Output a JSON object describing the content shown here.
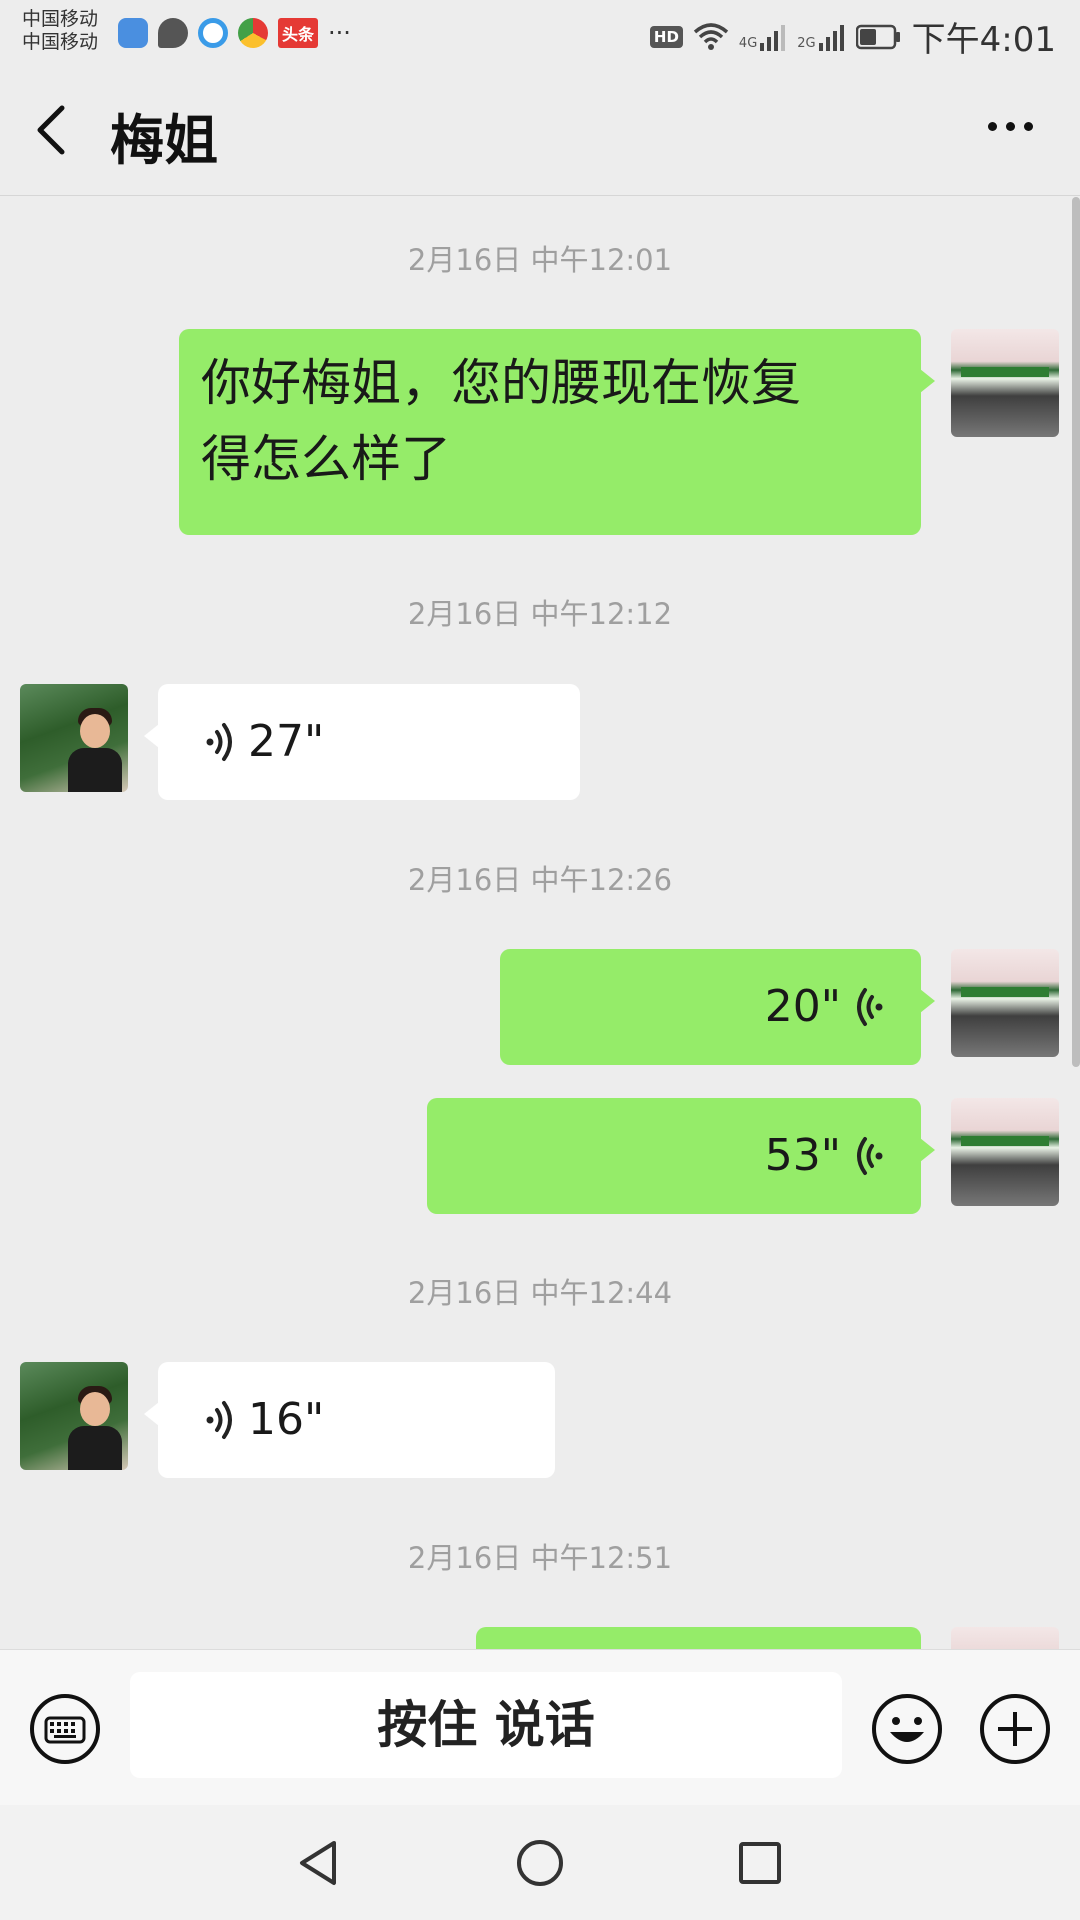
{
  "status_bar": {
    "carrier_1": "中国移动",
    "carrier_2": "中国移动",
    "notification_badge": "头条",
    "more": "···",
    "hd": "HD",
    "net_1": "4G",
    "net_2": "2G",
    "time": "下午4:01",
    "battery_level": 0.5
  },
  "header": {
    "title": "梅姐"
  },
  "messages": [
    {
      "type": "timestamp",
      "text": "2月16日 中午12:01"
    },
    {
      "type": "text",
      "sender": "me",
      "text_line1": "你好梅姐，您的腰现在恢复",
      "text_line2": "得怎么样了"
    },
    {
      "type": "timestamp",
      "text": "2月16日 中午12:12"
    },
    {
      "type": "voice",
      "sender": "other",
      "duration": "27\""
    },
    {
      "type": "timestamp",
      "text": "2月16日 中午12:26"
    },
    {
      "type": "voice",
      "sender": "me",
      "duration": "20\""
    },
    {
      "type": "voice",
      "sender": "me",
      "duration": "53\""
    },
    {
      "type": "timestamp",
      "text": "2月16日 中午12:44"
    },
    {
      "type": "voice",
      "sender": "other",
      "duration": "16\""
    },
    {
      "type": "timestamp",
      "text": "2月16日 中午12:51"
    }
  ],
  "input_bar": {
    "hold_to_talk": "按住 说话"
  },
  "colors": {
    "my_bubble": "#95ec69",
    "their_bubble": "#ffffff",
    "background": "#ededed"
  },
  "icons": [
    "back-arrow-icon",
    "more-dots-icon",
    "keyboard-icon",
    "emoji-icon",
    "plus-icon",
    "nav-back-icon",
    "nav-home-icon",
    "nav-recents-icon",
    "voice-wave-icon"
  ]
}
